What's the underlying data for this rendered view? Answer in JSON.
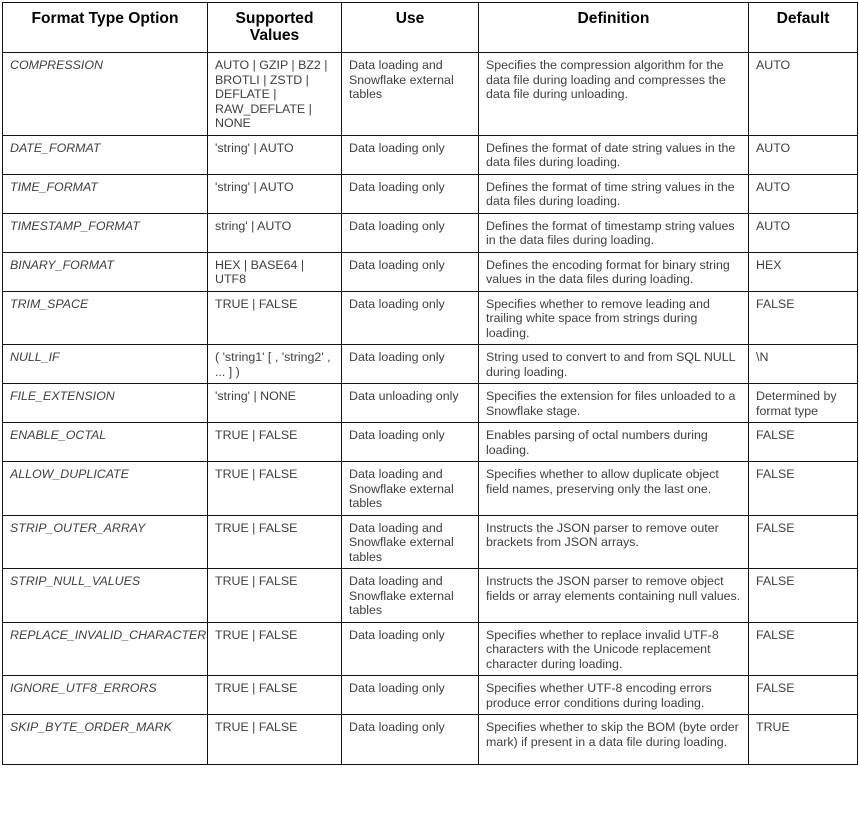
{
  "table": {
    "headers": [
      "Format Type Option",
      "Supported Values",
      "Use",
      "Definition",
      "Default"
    ],
    "rows": [
      {
        "option": "COMPRESSION",
        "values": "AUTO | GZIP | BZ2 | BROTLI | ZSTD | DEFLATE | RAW_DEFLATE | NONE",
        "use": "Data loading and Snowflake external tables",
        "definition": "Specifies the compression algorithm for the data file during loading and compresses the data file during unloading.",
        "default": "AUTO"
      },
      {
        "option": "DATE_FORMAT",
        "values": "'string' | AUTO",
        "use": "Data loading only",
        "definition": "Defines the format of date string values in the data files during loading.",
        "default": "AUTO"
      },
      {
        "option": "TIME_FORMAT",
        "values": "'string' | AUTO",
        "use": "Data loading only",
        "definition": "Defines the format of time string values in the data files during loading.",
        "default": "AUTO"
      },
      {
        "option": "TIMESTAMP_FORMAT",
        "values": "string' | AUTO",
        "use": "Data loading only",
        "definition": "Defines the format of timestamp string values in the data files during loading.",
        "default": "AUTO"
      },
      {
        "option": "BINARY_FORMAT",
        "values": "HEX | BASE64 | UTF8",
        "use": "Data loading only",
        "definition": "Defines the encoding format for binary string values in the data files during loading.",
        "default": "HEX"
      },
      {
        "option": "TRIM_SPACE",
        "values": "TRUE | FALSE",
        "use": "Data loading only",
        "definition": "Specifies whether to remove leading and trailing white space from strings during loading.",
        "default": "FALSE"
      },
      {
        "option": "NULL_IF",
        "values": "( 'string1' [ , 'string2' , ... ] )",
        "use": "Data loading only",
        "definition": "String used to convert to and from SQL NULL during loading.",
        "default": "\\N"
      },
      {
        "option": "FILE_EXTENSION",
        "values": "'string' | NONE",
        "use": "Data unloading only",
        "definition": "Specifies the extension for files unloaded to a Snowflake stage.",
        "default": "Determined by format type"
      },
      {
        "option": "ENABLE_OCTAL",
        "values": "TRUE | FALSE",
        "use": "Data loading only",
        "definition": "Enables parsing of octal numbers during loading.",
        "default": "FALSE"
      },
      {
        "option": "ALLOW_DUPLICATE",
        "values": "TRUE | FALSE",
        "use": "Data loading and Snowflake external tables",
        "definition": "Specifies whether to allow duplicate object field names, preserving only the last one.",
        "default": "FALSE"
      },
      {
        "option": "STRIP_OUTER_ARRAY",
        "values": "TRUE | FALSE",
        "use": "Data loading and Snowflake external tables",
        "definition": "Instructs the JSON parser to remove outer brackets from JSON arrays.",
        "default": "FALSE"
      },
      {
        "option": "STRIP_NULL_VALUES",
        "values": "TRUE | FALSE",
        "use": "Data loading and Snowflake external tables",
        "definition": "Instructs the JSON parser to remove object fields or array elements containing null values.",
        "default": "FALSE"
      },
      {
        "option": "REPLACE_INVALID_CHARACTERS",
        "values": " TRUE | FALSE",
        "use": "Data loading only",
        "definition": "Specifies whether to replace invalid UTF-8 characters with the Unicode replacement character during loading.",
        "default": "FALSE"
      },
      {
        "option": "IGNORE_UTF8_ERRORS",
        "values": "TRUE | FALSE",
        "use": "Data loading only",
        "definition": "Specifies whether UTF-8 encoding errors produce error conditions during loading.",
        "default": "FALSE"
      },
      {
        "option": "SKIP_BYTE_ORDER_MARK",
        "values": "TRUE | FALSE",
        "use": "Data loading only",
        "definition": "Specifies whether to skip the BOM (byte order mark) if present in a data file during loading.",
        "default": "TRUE"
      }
    ]
  }
}
